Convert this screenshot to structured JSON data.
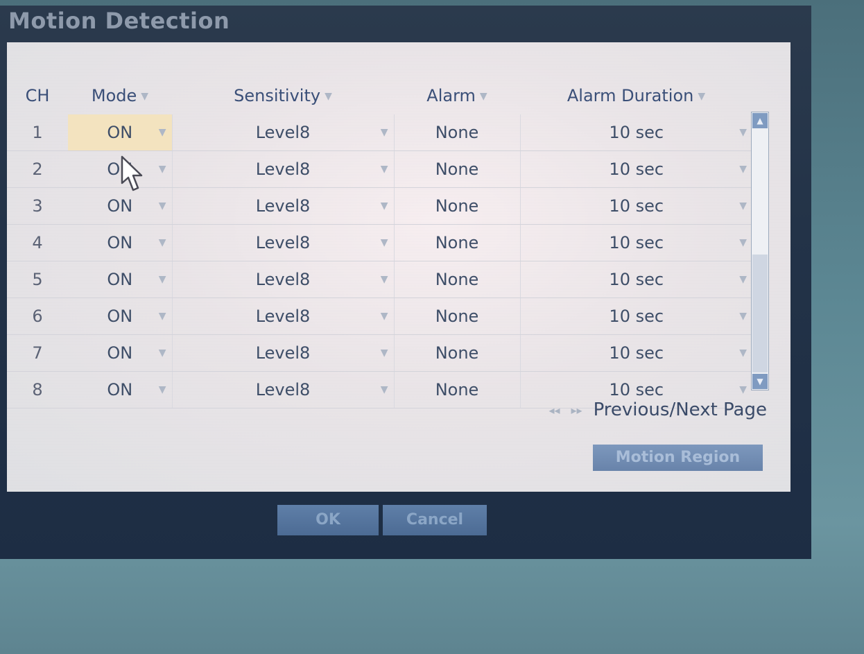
{
  "window": {
    "title": "Motion Detection"
  },
  "table": {
    "headers": {
      "ch": "CH",
      "mode": "Mode",
      "sensitivity": "Sensitivity",
      "alarm": "Alarm",
      "duration": "Alarm Duration"
    },
    "rows": [
      {
        "ch": "1",
        "mode": "ON",
        "sensitivity": "Level8",
        "alarm": "None",
        "duration": "10 sec"
      },
      {
        "ch": "2",
        "mode": "ON",
        "sensitivity": "Level8",
        "alarm": "None",
        "duration": "10 sec"
      },
      {
        "ch": "3",
        "mode": "ON",
        "sensitivity": "Level8",
        "alarm": "None",
        "duration": "10 sec"
      },
      {
        "ch": "4",
        "mode": "ON",
        "sensitivity": "Level8",
        "alarm": "None",
        "duration": "10 sec"
      },
      {
        "ch": "5",
        "mode": "ON",
        "sensitivity": "Level8",
        "alarm": "None",
        "duration": "10 sec"
      },
      {
        "ch": "6",
        "mode": "ON",
        "sensitivity": "Level8",
        "alarm": "None",
        "duration": "10 sec"
      },
      {
        "ch": "7",
        "mode": "ON",
        "sensitivity": "Level8",
        "alarm": "None",
        "duration": "10 sec"
      },
      {
        "ch": "8",
        "mode": "ON",
        "sensitivity": "Level8",
        "alarm": "None",
        "duration": "10 sec"
      }
    ]
  },
  "pager": {
    "label": "Previous/Next Page",
    "prev_icon": "double-left-arrow-icon",
    "next_icon": "double-right-arrow-icon"
  },
  "buttons": {
    "motion_region": "Motion Region",
    "ok": "OK",
    "cancel": "Cancel"
  },
  "icons": {
    "dropdown": "chevron-down-icon",
    "scroll_up": "scroll-up-arrow-icon",
    "scroll_down": "scroll-down-arrow-icon",
    "cursor": "mouse-pointer-icon"
  },
  "colors": {
    "selected_cell": "#f3e3bf",
    "header_text": "#3a4f78",
    "button": "#6883aa",
    "frame": "#233348"
  }
}
